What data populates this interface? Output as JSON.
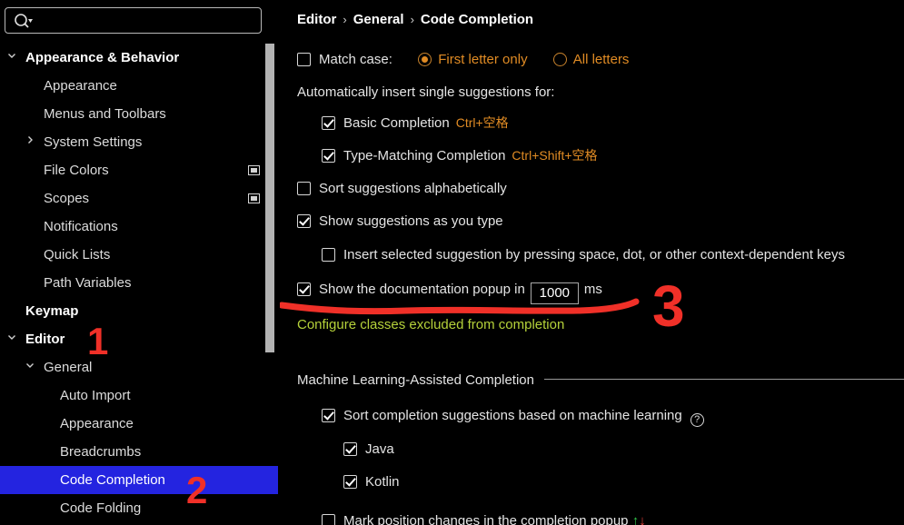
{
  "search": {
    "value": "",
    "placeholder": "",
    "icon": "search-icon",
    "dropdown_icon": "chevron-down-icon"
  },
  "sidebar": {
    "items": [
      {
        "label": "Appearance & Behavior",
        "indent": 28,
        "arrow": "v",
        "bold": true,
        "selected": false,
        "icon": null
      },
      {
        "label": "Appearance",
        "indent": 48,
        "arrow": null,
        "bold": false,
        "selected": false,
        "icon": null
      },
      {
        "label": "Menus and Toolbars",
        "indent": 48,
        "arrow": null,
        "bold": false,
        "selected": false,
        "icon": null
      },
      {
        "label": "System Settings",
        "indent": 48,
        "arrow": ">",
        "bold": false,
        "selected": false,
        "icon": null
      },
      {
        "label": "File Colors",
        "indent": 48,
        "arrow": null,
        "bold": false,
        "selected": false,
        "icon": "window-icon"
      },
      {
        "label": "Scopes",
        "indent": 48,
        "arrow": null,
        "bold": false,
        "selected": false,
        "icon": "window-icon"
      },
      {
        "label": "Notifications",
        "indent": 48,
        "arrow": null,
        "bold": false,
        "selected": false,
        "icon": null
      },
      {
        "label": "Quick Lists",
        "indent": 48,
        "arrow": null,
        "bold": false,
        "selected": false,
        "icon": null
      },
      {
        "label": "Path Variables",
        "indent": 48,
        "arrow": null,
        "bold": false,
        "selected": false,
        "icon": null
      },
      {
        "label": "Keymap",
        "indent": 28,
        "arrow": null,
        "bold": true,
        "selected": false,
        "icon": null
      },
      {
        "label": "Editor",
        "indent": 28,
        "arrow": "v",
        "bold": true,
        "selected": false,
        "icon": null
      },
      {
        "label": "General",
        "indent": 48,
        "arrow": "v",
        "bold": false,
        "selected": false,
        "icon": null
      },
      {
        "label": "Auto Import",
        "indent": 66,
        "arrow": null,
        "bold": false,
        "selected": false,
        "icon": null
      },
      {
        "label": "Appearance",
        "indent": 66,
        "arrow": null,
        "bold": false,
        "selected": false,
        "icon": null
      },
      {
        "label": "Breadcrumbs",
        "indent": 66,
        "arrow": null,
        "bold": false,
        "selected": false,
        "icon": null
      },
      {
        "label": "Code Completion",
        "indent": 66,
        "arrow": null,
        "bold": false,
        "selected": true,
        "icon": null
      },
      {
        "label": "Code Folding",
        "indent": 66,
        "arrow": null,
        "bold": false,
        "selected": false,
        "icon": null
      }
    ]
  },
  "breadcrumb": {
    "part1": "Editor",
    "part2": "General",
    "part3": "Code Completion",
    "separator": "›"
  },
  "main": {
    "match_case": {
      "label": "Match case:",
      "checked": false,
      "options": [
        {
          "label": "First letter only",
          "selected": true
        },
        {
          "label": "All letters",
          "selected": false
        }
      ]
    },
    "auto_insert_header": "Automatically insert single suggestions for:",
    "auto_insert_items": [
      {
        "label": "Basic Completion",
        "checked": true,
        "shortcut": "Ctrl+空格"
      },
      {
        "label": "Type-Matching Completion",
        "checked": true,
        "shortcut": "Ctrl+Shift+空格"
      }
    ],
    "sort_alpha": {
      "label": "Sort suggestions alphabetically",
      "checked": false
    },
    "show_suggestions": {
      "label": "Show suggestions as you type",
      "checked": true
    },
    "insert_selected": {
      "label": "Insert selected suggestion by pressing space, dot, or other context-dependent keys",
      "checked": false
    },
    "doc_popup": {
      "label_before": "Show the documentation popup in",
      "value": "1000",
      "unit": "ms",
      "checked": true
    },
    "configure_link": "Configure classes excluded from completion",
    "ml_section": {
      "title": "Machine Learning-Assisted Completion",
      "sort_ml": {
        "label": "Sort completion suggestions based on machine learning",
        "checked": true,
        "help": "?"
      },
      "languages": [
        {
          "label": "Java",
          "checked": true
        },
        {
          "label": "Kotlin",
          "checked": true
        }
      ],
      "mark_position": {
        "label": "Mark position changes in the completion popup",
        "checked": false,
        "up": "↑",
        "down": "↓"
      }
    }
  },
  "annotations": {
    "marker1": "1",
    "marker2": "2",
    "marker3": "3",
    "color": "#f03028"
  }
}
